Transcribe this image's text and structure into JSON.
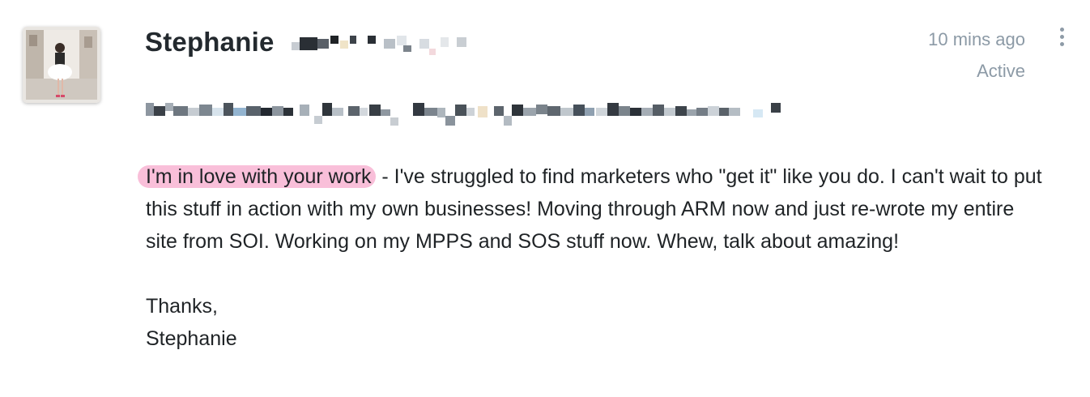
{
  "sender": {
    "name": "Stephanie",
    "avatar_icon": "profile-photo"
  },
  "meta": {
    "timestamp": "10 mins ago",
    "status": "Active"
  },
  "menu": {
    "icon": "vertical-ellipsis-icon"
  },
  "message": {
    "highlight": "I'm in love with your work",
    "body_rest": " - I've struggled to find marketers who \"get it\" like you do. I can't wait to put this stuff in action with my own businesses! Moving through ARM now and just re-wrote my entire site from SOI. Working on my MPPS and SOS stuff now. Whew, talk about amazing!",
    "closing": "Thanks,",
    "signature": "Stephanie"
  },
  "colors": {
    "highlight": "#f7aacc",
    "meta_text": "#8c9aa6",
    "body_text": "#1f2326"
  }
}
